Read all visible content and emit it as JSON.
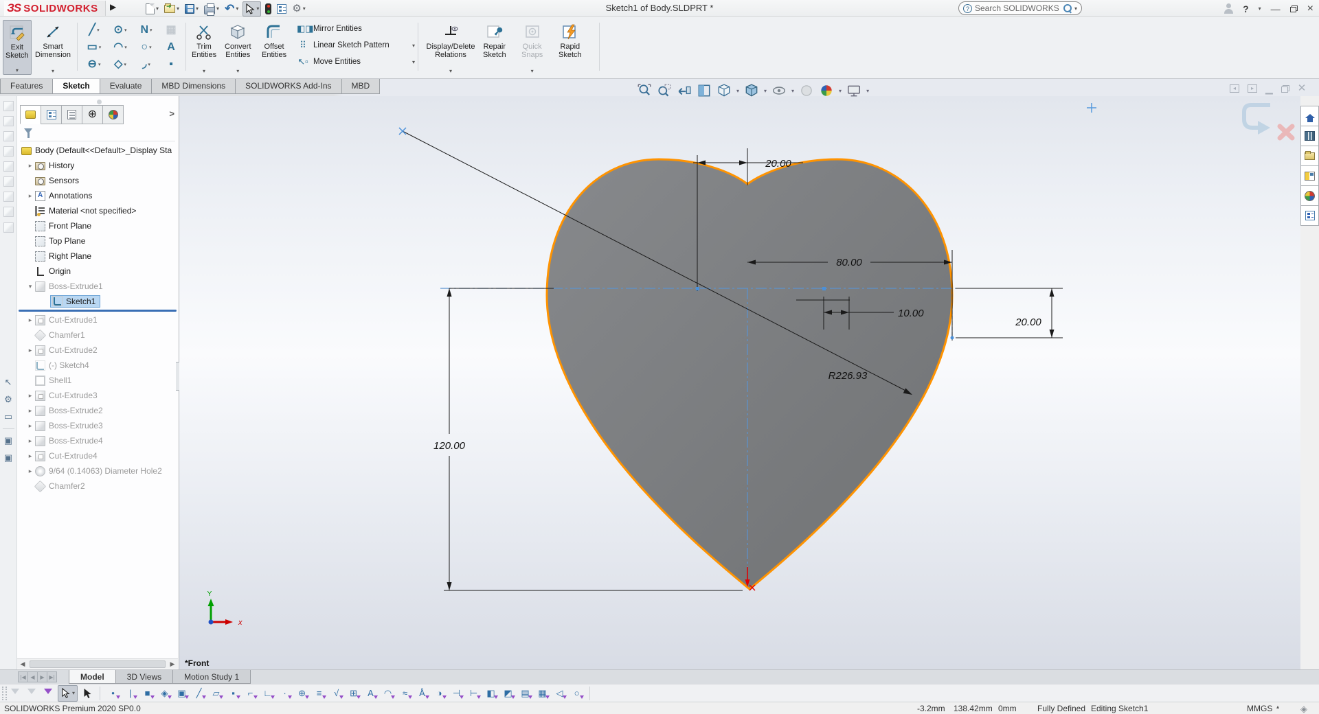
{
  "titlebar": {
    "brand_prefix": "ЗS",
    "brand": "SOLIDWORKS",
    "title": "Sketch1 of Body.SLDPRT *",
    "search_placeholder": "Search SOLIDWORKS Help"
  },
  "command_tabs": {
    "items": [
      "Features",
      "Sketch",
      "Evaluate",
      "MBD Dimensions",
      "SOLIDWORKS Add-Ins",
      "MBD"
    ],
    "active": "Sketch"
  },
  "ribbon": {
    "exit_sketch": "Exit\nSketch",
    "smart_dimension": "Smart\nDimension",
    "trim": "Trim\nEntities",
    "convert": "Convert\nEntities",
    "offset": "Offset\nEntities",
    "mirror": "Mirror Entities",
    "linear_pattern": "Linear Sketch Pattern",
    "move": "Move Entities",
    "display_delete": "Display/Delete\nRelations",
    "repair": "Repair\nSketch",
    "quick_snaps": "Quick\nSnaps",
    "rapid": "Rapid\nSketch",
    "entity_tools": [
      {
        "name": "line-tool",
        "glyph": "╱",
        "dd": true
      },
      {
        "name": "circle-tool",
        "glyph": "⊙",
        "dd": true
      },
      {
        "name": "spline-tool",
        "glyph": "N",
        "dd": true
      },
      {
        "name": "pattern-grid-tool",
        "glyph": "▦",
        "dd": false,
        "faded": true
      },
      {
        "name": "corner-rectangle-tool",
        "glyph": "▭",
        "dd": true
      },
      {
        "name": "arc-tool",
        "glyph": "◠",
        "dd": true
      },
      {
        "name": "ellipse-tool",
        "glyph": "○",
        "dd": true
      },
      {
        "name": "text-tool",
        "glyph": "A",
        "dd": false
      },
      {
        "name": "slot-tool",
        "glyph": "⊖",
        "dd": true
      },
      {
        "name": "polygon-tool",
        "glyph": "◇",
        "dd": true
      },
      {
        "name": "sketch-fillet-tool",
        "glyph": "◞",
        "dd": true
      },
      {
        "name": "point-tool",
        "glyph": "▪",
        "dd": false
      }
    ]
  },
  "tree": {
    "root": "Body  (Default<<Default>_Display Sta",
    "items": [
      {
        "label": "History",
        "arrow": "r",
        "icon": "folder",
        "state": "normal"
      },
      {
        "label": "Sensors",
        "arrow": "",
        "icon": "sensor",
        "state": "normal"
      },
      {
        "label": "Annotations",
        "arrow": "r",
        "icon": "annot",
        "state": "normal"
      },
      {
        "label": "Material <not specified>",
        "arrow": "",
        "icon": "material",
        "state": "normal"
      },
      {
        "label": "Front Plane",
        "arrow": "",
        "icon": "plane",
        "state": "normal"
      },
      {
        "label": "Top Plane",
        "arrow": "",
        "icon": "plane",
        "state": "normal"
      },
      {
        "label": "Right Plane",
        "arrow": "",
        "icon": "plane",
        "state": "normal"
      },
      {
        "label": "Origin",
        "arrow": "",
        "icon": "origin",
        "state": "normal"
      },
      {
        "label": "Boss-Extrude1",
        "arrow": "d",
        "icon": "boss",
        "state": "gray"
      },
      {
        "label": "Sketch1",
        "arrow": "",
        "icon": "sketch",
        "state": "selected",
        "indent": 2
      },
      {
        "label": "Cut-Extrude1",
        "arrow": "r",
        "icon": "cut",
        "state": "gray",
        "rollback_before": true
      },
      {
        "label": "Chamfer1",
        "arrow": "",
        "icon": "chamfer",
        "state": "gray"
      },
      {
        "label": "Cut-Extrude2",
        "arrow": "r",
        "icon": "cut",
        "state": "gray"
      },
      {
        "label": "(-) Sketch4",
        "arrow": "",
        "icon": "sketch",
        "state": "gray"
      },
      {
        "label": "Shell1",
        "arrow": "",
        "icon": "shell",
        "state": "gray"
      },
      {
        "label": "Cut-Extrude3",
        "arrow": "r",
        "icon": "cut",
        "state": "gray"
      },
      {
        "label": "Boss-Extrude2",
        "arrow": "r",
        "icon": "boss",
        "state": "gray"
      },
      {
        "label": "Boss-Extrude3",
        "arrow": "r",
        "icon": "boss",
        "state": "gray"
      },
      {
        "label": "Boss-Extrude4",
        "arrow": "r",
        "icon": "boss",
        "state": "gray"
      },
      {
        "label": "Cut-Extrude4",
        "arrow": "r",
        "icon": "cut",
        "state": "gray"
      },
      {
        "label": "9/64 (0.14063) Diameter Hole2",
        "arrow": "r",
        "icon": "hole",
        "state": "gray"
      },
      {
        "label": "Chamfer2",
        "arrow": "",
        "icon": "chamfer",
        "state": "gray"
      }
    ]
  },
  "viewport": {
    "view_label": "*Front",
    "dimensions": {
      "lobe": "20.00",
      "half_width": "80.00",
      "notch": "10.00",
      "right_offset": "20.00",
      "height": "120.00",
      "radius": "R226.93"
    },
    "triad": {
      "x": "x",
      "y": "Y"
    }
  },
  "doc_tabs": {
    "items": [
      "Model",
      "3D Views",
      "Motion Study 1"
    ],
    "active": "Model"
  },
  "filter_bar": {
    "icons": [
      {
        "name": "filter-vertices",
        "glyph": "•"
      },
      {
        "name": "filter-edges",
        "glyph": "|"
      },
      {
        "name": "filter-faces",
        "glyph": "■"
      },
      {
        "name": "filter-surface-bodies",
        "glyph": "◈"
      },
      {
        "name": "filter-solid-bodies",
        "glyph": "▣"
      },
      {
        "name": "filter-axes",
        "glyph": "╱"
      },
      {
        "name": "filter-planes",
        "glyph": "▱"
      },
      {
        "name": "filter-sketch-points",
        "glyph": "▪"
      },
      {
        "name": "filter-sketches",
        "glyph": "⌐"
      },
      {
        "name": "filter-sketch-segments",
        "glyph": "∟"
      },
      {
        "name": "filter-midpoints",
        "glyph": "∙"
      },
      {
        "name": "filter-center-marks",
        "glyph": "⊕"
      },
      {
        "name": "filter-centerlines",
        "glyph": "≡"
      },
      {
        "name": "filter-dimensions",
        "glyph": "√"
      },
      {
        "name": "filter-hole-callouts",
        "glyph": "⊞"
      },
      {
        "name": "filter-notes",
        "glyph": "A"
      },
      {
        "name": "filter-surface-finish",
        "glyph": "◠"
      },
      {
        "name": "filter-weld-symbols",
        "glyph": "≈"
      },
      {
        "name": "filter-geometric-tolerances",
        "glyph": "Å"
      },
      {
        "name": "filter-datums",
        "glyph": "◑"
      },
      {
        "name": "filter-datum-targets",
        "glyph": "⊣"
      },
      {
        "name": "filter-blocks",
        "glyph": "⊢"
      },
      {
        "name": "filter-cosmetic-threads",
        "glyph": "◧"
      },
      {
        "name": "filter-dowel-symbols",
        "glyph": "◩"
      },
      {
        "name": "filter-connection-points",
        "glyph": "▤"
      },
      {
        "name": "filter-routing-points",
        "glyph": "▦"
      },
      {
        "name": "filter-weld-beads",
        "glyph": "◁"
      },
      {
        "name": "filter-reference-points",
        "glyph": "○"
      }
    ]
  },
  "status_bar": {
    "product": "SOLIDWORKS Premium 2020 SP0.0",
    "x": "-3.2mm",
    "y": "138.42mm",
    "z": "0mm",
    "state": "Fully Defined",
    "mode": "Editing Sketch1",
    "units": "MMGS"
  }
}
